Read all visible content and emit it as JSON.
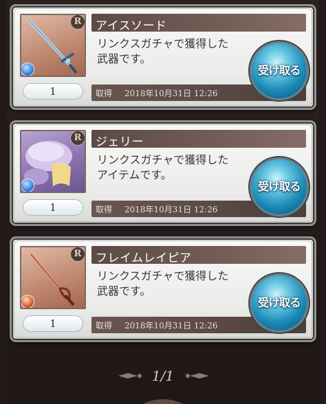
{
  "items": [
    {
      "name": "アイスソード",
      "description_lines": [
        "リンクスガチャで獲得した",
        "武器です。"
      ],
      "quantity": "1",
      "acquired_label": "取得",
      "acquired_date": "2018年10月31日 12:26",
      "rarity": "R",
      "button_label": "受け取る",
      "element_color": "#3b7fe0",
      "icon": "ice-sword-icon"
    },
    {
      "name": "ジェリー",
      "description_lines": [
        "リンクスガチャで獲得した",
        "アイテムです。"
      ],
      "quantity": "1",
      "acquired_label": "取得",
      "acquired_date": "2018年10月31日 12:26",
      "rarity": "R",
      "button_label": "受け取る",
      "element_color": "#3b7fe0",
      "icon": "jelly-character-icon"
    },
    {
      "name": "フレイムレイピア",
      "description_lines": [
        "リンクスガチャで獲得した",
        "武器です。"
      ],
      "quantity": "1",
      "acquired_label": "取得",
      "acquired_date": "2018年10月31日 12:26",
      "rarity": "R",
      "button_label": "受け取る",
      "element_color": "#e05a2b",
      "icon": "flame-rapier-icon"
    }
  ],
  "pager": {
    "text": "1/1"
  }
}
